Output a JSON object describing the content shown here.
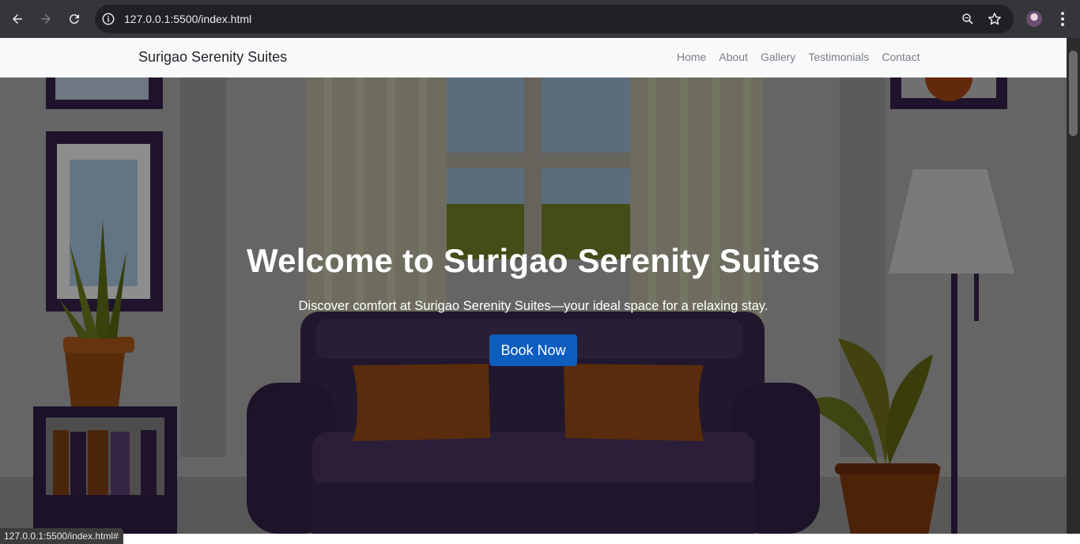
{
  "browser": {
    "url": "127.0.0.1:5500/index.html",
    "status_url": "127.0.0.1:5500/index.html#",
    "icons": [
      "back-arrow-icon",
      "forward-arrow-icon",
      "reload-icon",
      "site-info-icon",
      "zoom-icon",
      "bookmark-star-icon",
      "profile-avatar",
      "kebab-menu-icon"
    ]
  },
  "navbar": {
    "brand": "Surigao Serenity Suites",
    "links": [
      "Home",
      "About",
      "Gallery",
      "Testimonials",
      "Contact"
    ]
  },
  "hero": {
    "title": "Welcome to Surigao Serenity Suites",
    "subtitle": "Discover comfort at Surigao Serenity Suites—your ideal space for a relaxing stay.",
    "button": "Book Now"
  },
  "colors": {
    "navbar_bg": "#f8f9fa",
    "button_bg": "#0d5dbf",
    "chrome_bg": "#35363a"
  }
}
